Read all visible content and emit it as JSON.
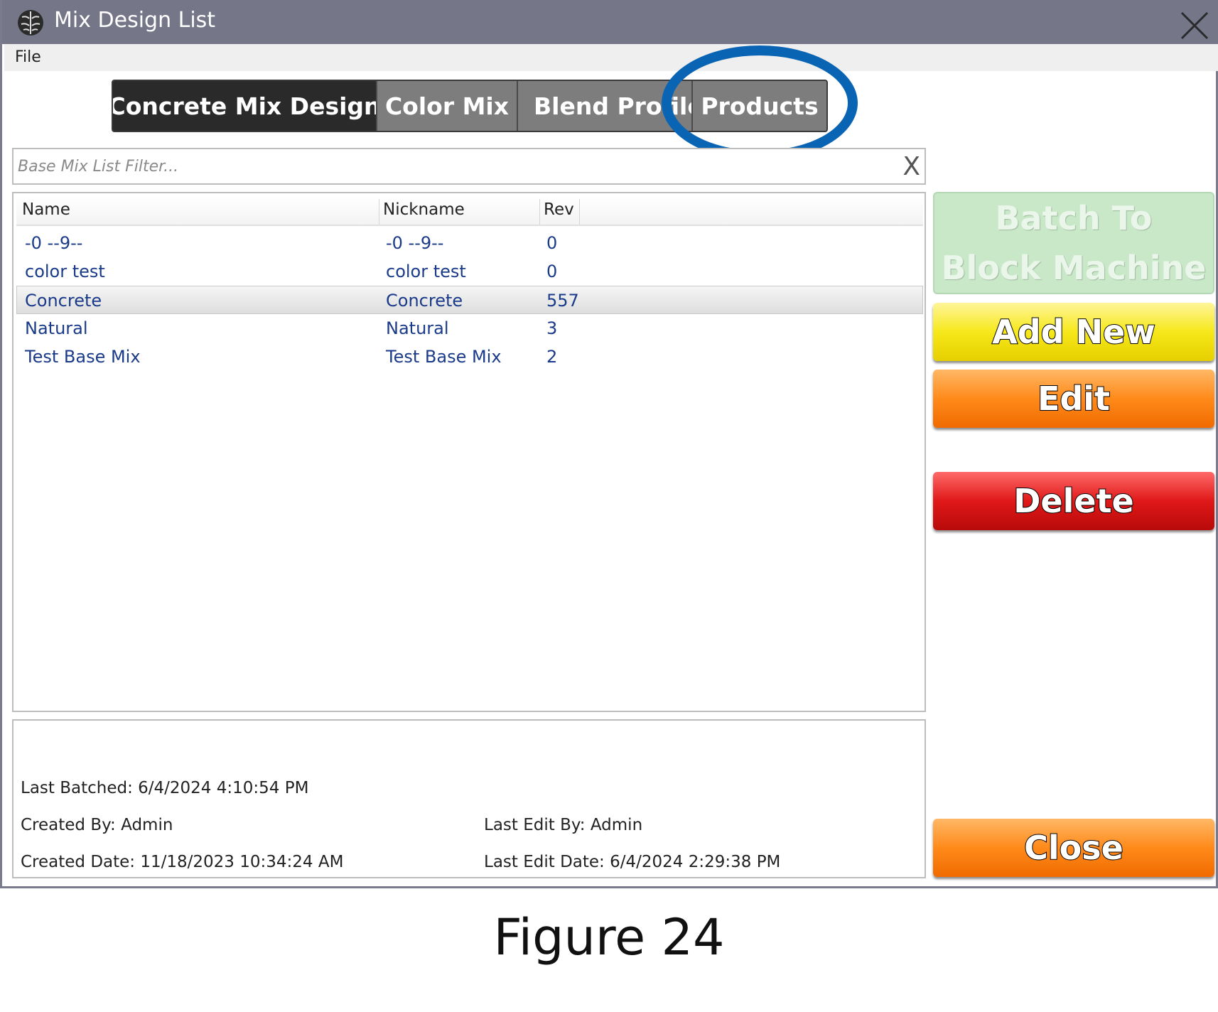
{
  "window": {
    "title": "Mix Design List",
    "icon": "brain-icon"
  },
  "menu": {
    "file": "File"
  },
  "tabs": [
    {
      "label": "Concrete Mix Design",
      "active": true
    },
    {
      "label": "Color Mix",
      "active": false
    },
    {
      "label": "Blend Profile",
      "active": false
    },
    {
      "label": "Products",
      "active": false
    }
  ],
  "annotation": {
    "highlight_color": "#0a64b4",
    "highlighted_tab": "Products"
  },
  "filter": {
    "placeholder": "Base Mix List Filter...",
    "value": "",
    "clear_label": "X"
  },
  "list": {
    "columns": [
      "Name",
      "Nickname",
      "Rev"
    ],
    "rows": [
      {
        "name": "-0 --9--",
        "nickname": "-0 --9--",
        "rev": "0"
      },
      {
        "name": "color test",
        "nickname": "color test",
        "rev": "0"
      },
      {
        "name": "Concrete",
        "nickname": "Concrete",
        "rev": "557"
      },
      {
        "name": "Natural",
        "nickname": "Natural",
        "rev": "3"
      },
      {
        "name": "Test Base Mix",
        "nickname": "Test Base Mix",
        "rev": "2"
      }
    ],
    "selected_row": "Concrete"
  },
  "details": {
    "last_batched": "Last Batched: 6/4/2024 4:10:54 PM",
    "created_by": "Created By: Admin",
    "created_date": "Created Date: 11/18/2023 10:34:24 AM",
    "last_edit_by": "Last Edit By: Admin",
    "last_edit_date": "Last Edit Date: 6/4/2024 2:29:38 PM"
  },
  "buttons": {
    "batch_line1": "Batch To",
    "batch_line2": "Block Machine",
    "add_new": "Add New",
    "edit": "Edit",
    "delete": "Delete",
    "close": "Close"
  },
  "colors": {
    "titlebar": "#767689",
    "add_new": "#f6e81a",
    "edit": "#ff8a1a",
    "delete": "#e01818",
    "close": "#ff8a1a",
    "batch_disabled": "#c8e8c8",
    "row_text": "#1a3a8a"
  },
  "caption": "Figure 24"
}
